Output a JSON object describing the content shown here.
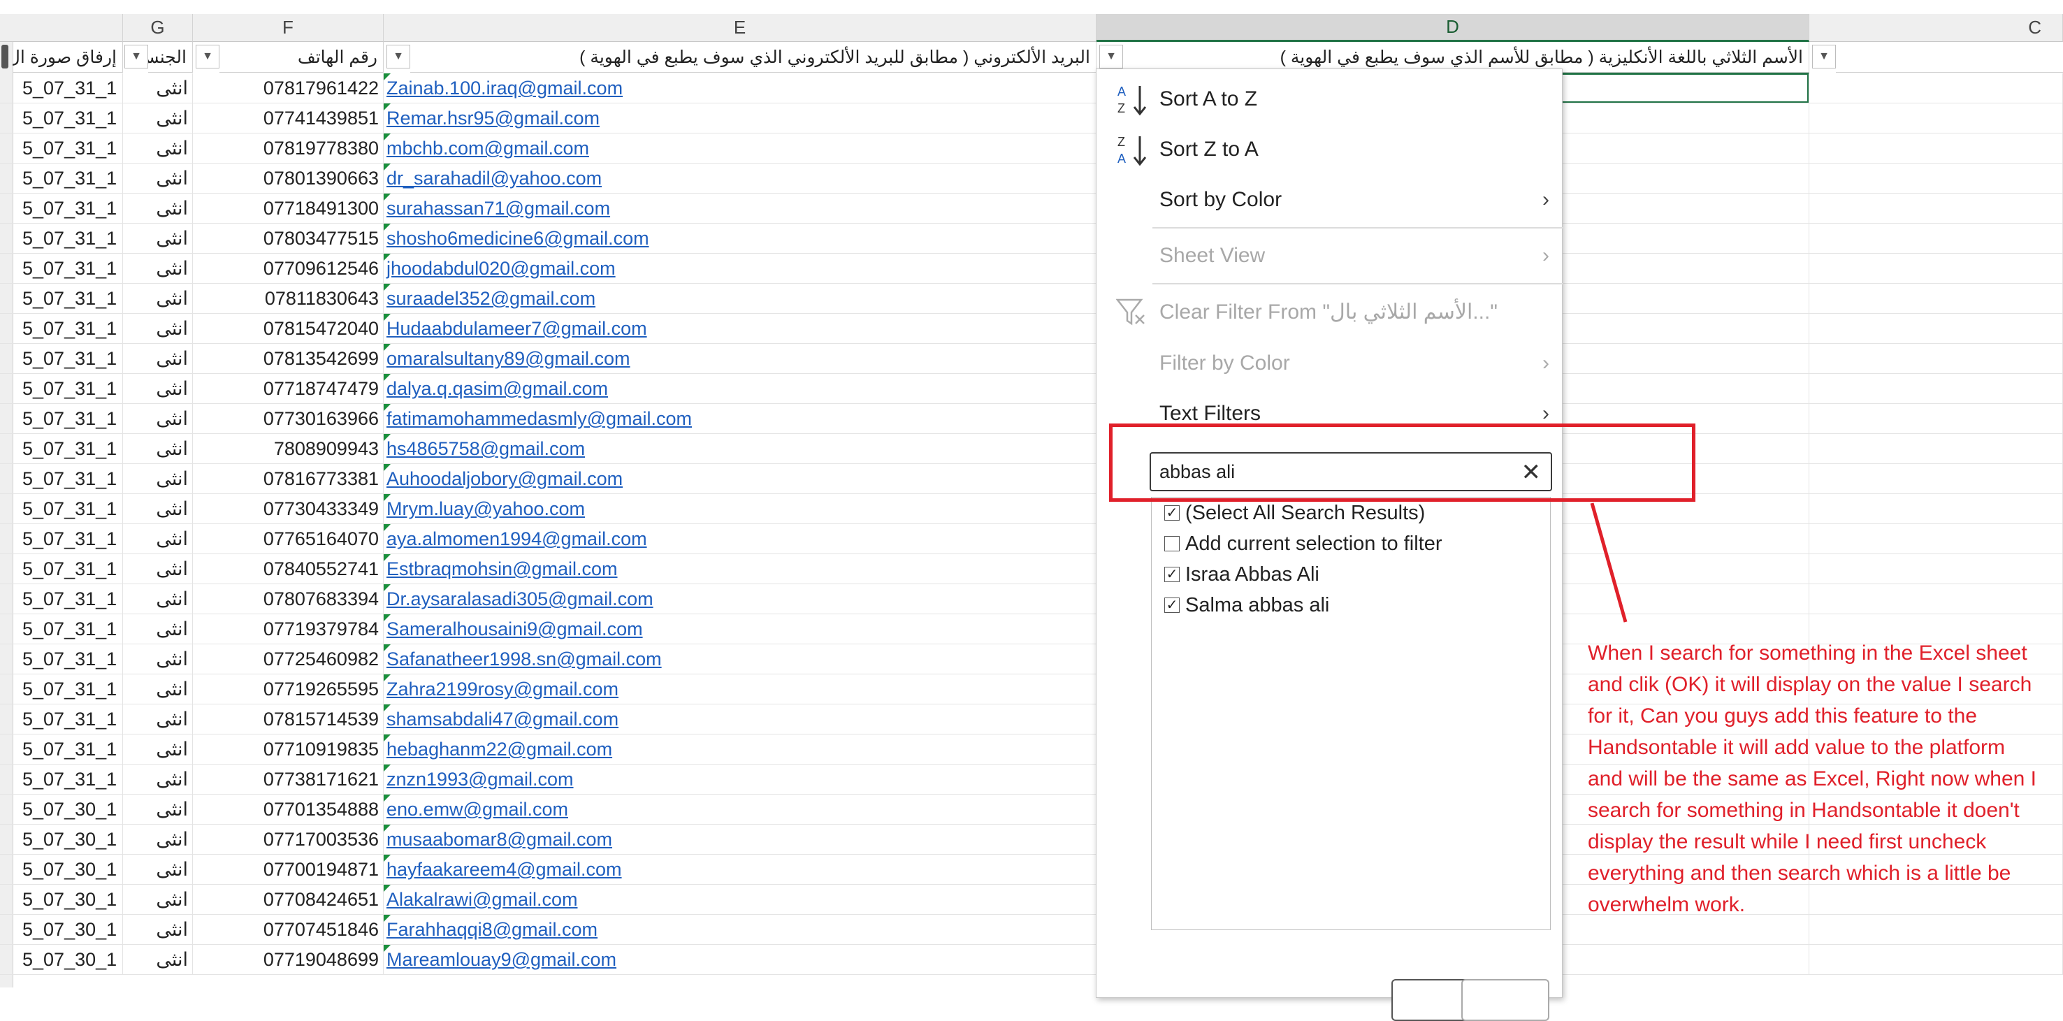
{
  "columns": {
    "H": "",
    "G": "G",
    "F": "F",
    "E": "E",
    "D": "D",
    "C": "C"
  },
  "filter_headers": {
    "h": "إرفاق صورة ال",
    "g": "الجنس",
    "f": "رقم الهاتف",
    "e": "البريد الألكتروني ( مطابق للبريد الألكتروني الذي سوف يطبع في الهوية )",
    "d": "الأسم الثلاثي باللغة الأنكليزية ( مطابق للأسم الذي سوف يطبع في الهوية )"
  },
  "rows": [
    {
      "h": "5_07_31_1",
      "g": "انثى",
      "f": "07817961422",
      "e": "Zainab.100.iraq@gmail.com"
    },
    {
      "h": "5_07_31_1",
      "g": "انثى",
      "f": "07741439851",
      "e": "Remar.hsr95@gmail.com"
    },
    {
      "h": "5_07_31_1",
      "g": "انثى",
      "f": "07819778380",
      "e": "mbchb.com@gmail.com"
    },
    {
      "h": "5_07_31_1",
      "g": "انثى",
      "f": "07801390663",
      "e": "dr_sarahadil@yahoo.com"
    },
    {
      "h": "5_07_31_1",
      "g": "انثى",
      "f": "07718491300",
      "e": "surahassan71@gmail.com"
    },
    {
      "h": "5_07_31_1",
      "g": "انثى",
      "f": "07803477515",
      "e": "shosho6medicine6@gmail.com"
    },
    {
      "h": "5_07_31_1",
      "g": "انثى",
      "f": "07709612546",
      "e": "jhoodabdul020@gmail.com"
    },
    {
      "h": "5_07_31_1",
      "g": "انثى",
      "f": "07811830643",
      "e": "suraadel352@gmail.com"
    },
    {
      "h": "5_07_31_1",
      "g": "انثى",
      "f": "07815472040",
      "e": "Hudaabdulameer7@gmail.com"
    },
    {
      "h": "5_07_31_1",
      "g": "انثى",
      "f": "07813542699",
      "e": "omaralsultany89@gmail.com"
    },
    {
      "h": "5_07_31_1",
      "g": "انثى",
      "f": "07718747479",
      "e": "dalya.q.qasim@gmail.com"
    },
    {
      "h": "5_07_31_1",
      "g": "انثى",
      "f": "07730163966",
      "e": "fatimamohammedasmly@gmail.com"
    },
    {
      "h": "5_07_31_1",
      "g": "انثى",
      "f": "7808909943",
      "e": "hs4865758@gmail.com"
    },
    {
      "h": "5_07_31_1",
      "g": "انثى",
      "f": "07816773381",
      "e": "Auhoodaljobory@gmail.com"
    },
    {
      "h": "5_07_31_1",
      "g": "انثى",
      "f": "07730433349",
      "e": "Mrym.luay@yahoo.com"
    },
    {
      "h": "5_07_31_1",
      "g": "انثى",
      "f": "07765164070",
      "e": "aya.almomen1994@gmail.com"
    },
    {
      "h": "5_07_31_1",
      "g": "انثى",
      "f": "07840552741",
      "e": "Estbraqmohsin@gmail.com"
    },
    {
      "h": "5_07_31_1",
      "g": "انثى",
      "f": "07807683394",
      "e": "Dr.aysaralasadi305@gmail.com"
    },
    {
      "h": "5_07_31_1",
      "g": "انثى",
      "f": "07719379784",
      "e": "Sameralhousaini9@gmail.com"
    },
    {
      "h": "5_07_31_1",
      "g": "انثى",
      "f": "07725460982",
      "e": "Safanatheer1998.sn@gmail.com"
    },
    {
      "h": "5_07_31_1",
      "g": "انثى",
      "f": "07719265595",
      "e": "Zahra2199rosy@gmail.com"
    },
    {
      "h": "5_07_31_1",
      "g": "انثى",
      "f": "07815714539",
      "e": "shamsabdali47@gmail.com"
    },
    {
      "h": "5_07_31_1",
      "g": "انثى",
      "f": "07710919835",
      "e": "hebaghanm22@gmail.com"
    },
    {
      "h": "5_07_31_1",
      "g": "انثى",
      "f": "07738171621",
      "e": "znzn1993@gmail.com"
    },
    {
      "h": "5_07_30_1",
      "g": "انثى",
      "f": "07701354888",
      "e": "eno.emw@gmail.com"
    },
    {
      "h": "5_07_30_1",
      "g": "انثى",
      "f": "07717003536",
      "e": "musaabomar8@gmail.com"
    },
    {
      "h": "5_07_30_1",
      "g": "انثى",
      "f": "07700194871",
      "e": "hayfaakareem4@gmail.com"
    },
    {
      "h": "5_07_30_1",
      "g": "انثى",
      "f": "07708424651",
      "e": "Alakalrawi@gmail.com"
    },
    {
      "h": "5_07_30_1",
      "g": "انثى",
      "f": "07707451846",
      "e": "Farahhaqqi8@gmail.com"
    },
    {
      "h": "5_07_30_1",
      "g": "انثى",
      "f": "07719048699",
      "e": "Mareamlouay9@gmail.com"
    }
  ],
  "menu": {
    "sort_az": "Sort A to Z",
    "sort_za": "Sort Z to A",
    "sort_color": "Sort by Color",
    "sheet_view": "Sheet View",
    "clear_filter": "Clear Filter From \"الأسم الثلاثي بال...\"",
    "filter_color": "Filter by Color",
    "text_filters": "Text Filters",
    "search_value": "abbas ali",
    "list": [
      {
        "label": "(Select All Search Results)",
        "checked": true
      },
      {
        "label": "Add current selection to filter",
        "checked": false
      },
      {
        "label": "Israa Abbas Ali",
        "checked": true
      },
      {
        "label": "Salma abbas ali",
        "checked": true
      }
    ]
  },
  "annotation": "When I search for something in the Excel sheet and clik (OK) it will display on the value I search for it, Can you guys add this feature to the Handsontable it will add value to the platform and will be the same as Excel, Right now when I search for something in Handsontable it doen't display the result while I need first uncheck everything and then search which is a little be overwhelm work.",
  "colors": {
    "accent": "#217346",
    "link": "#1f5fbf",
    "annotation": "#e0202a"
  }
}
